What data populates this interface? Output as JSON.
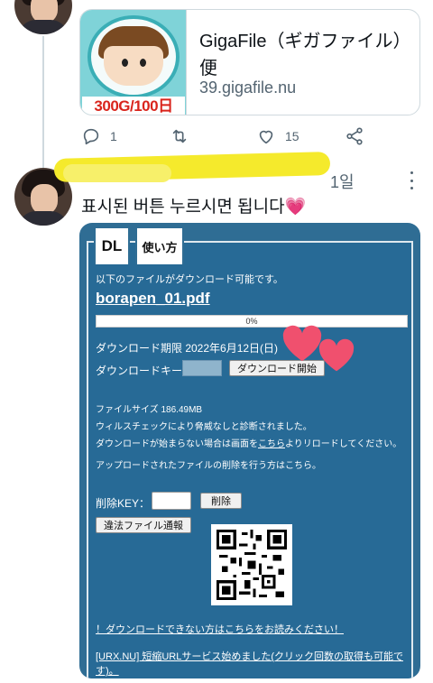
{
  "link_card": {
    "thumbnail_label": "300G/100日",
    "title": "GigaFile（ギガファイル）便",
    "domain": "39.gigafile.nu"
  },
  "actions": {
    "reply_count": "1",
    "retweet_count": "",
    "like_count": "15"
  },
  "reply": {
    "time": "1일",
    "text": "표시된 버튼 누르시면 됩니다💗"
  },
  "page": {
    "tabs": [
      "DL",
      "使い方"
    ],
    "available_text": "以下のファイルがダウンロード可能です。",
    "filename": "borapen_01.pdf",
    "progress": 0,
    "progress_label": "0%",
    "deadline_text": "ダウンロード期限 2022年6月12日(日)",
    "key_label": "ダウンロードキー",
    "download_button": "ダウンロード開始",
    "file_size": "ファイルサイズ 186.49MB",
    "virus_check": "ウィルスチェックにより脅威なしと診断されました。",
    "reload_prefix": "ダウンロードが始まらない場合は画面を",
    "reload_link": "こちら",
    "reload_suffix": "よりリロードしてください。",
    "uploader_note": "アップロードされたファイルの削除を行う方はこちら。",
    "delete_key_label": "削除KEY：",
    "delete_button": "削除",
    "report_button": "違法ファイル通報",
    "help_link": "！ダウンロードできない方はこちらをお読みください！",
    "promo_link_line1": "[URX.NU] 短縮URLサービス始めました(クリック回数の取得も可能で",
    "promo_link_line2": "す)。"
  },
  "colors": {
    "page_blue": "#276a96",
    "heart": "#f0506e",
    "highlight": "#f5ea2c"
  }
}
